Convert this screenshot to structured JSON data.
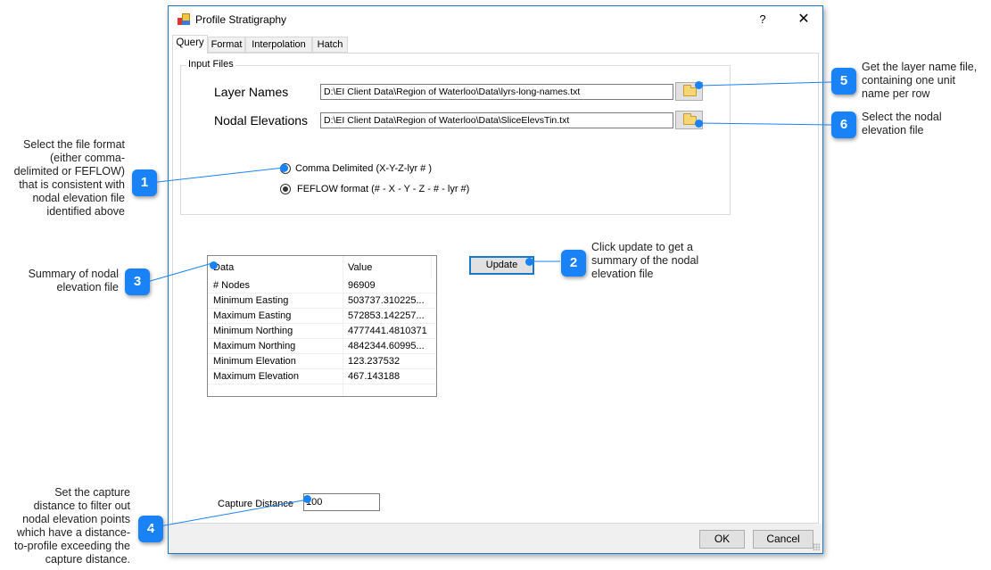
{
  "window": {
    "title": "Profile Stratigraphy",
    "help_label": "?",
    "close_label": "✕",
    "icon": "app-icon"
  },
  "tabs": [
    {
      "label": "Query",
      "active": true
    },
    {
      "label": "Format",
      "active": false
    },
    {
      "label": "Interpolation",
      "active": false
    },
    {
      "label": "Hatch",
      "active": false
    }
  ],
  "input_files": {
    "legend": "Input Files",
    "layer_names": {
      "label": "Layer Names",
      "value": "D:\\EI Client Data\\Region of Waterloo\\Data\\lyrs-long-names.txt",
      "browse_icon": "folder-open-icon"
    },
    "nodal_elevations": {
      "label": "Nodal Elevations",
      "value": "D:\\EI Client Data\\Region of Waterloo\\Data\\SliceElevsTin.txt",
      "browse_icon": "folder-open-icon"
    },
    "formats": [
      {
        "label": "Comma Delimited (X-Y-Z-lyr # )",
        "checked": false
      },
      {
        "label": "FEFLOW format (# - X - Y - Z - # - lyr #)",
        "checked": true
      }
    ]
  },
  "summary_grid": {
    "headers": [
      "Data",
      "Value"
    ],
    "rows": [
      [
        "# Nodes",
        "96909"
      ],
      [
        "Minimum Easting",
        "503737.310225..."
      ],
      [
        "Maximum Easting",
        "572853.142257..."
      ],
      [
        "Minimum Northing",
        "4777441.4810371"
      ],
      [
        "Maximum Northing",
        "4842344.60995..."
      ],
      [
        "Minimum Elevation",
        "123.237532"
      ],
      [
        "Maximum Elevation",
        "467.143188"
      ]
    ]
  },
  "update_label": "Update",
  "capture": {
    "label": "Capture Distance",
    "value": "100"
  },
  "footer": {
    "ok_label": "OK",
    "cancel_label": "Cancel"
  },
  "callouts": [
    {
      "number": "1",
      "text": "Select the file format (either comma-delimited or FEFLOW) that is consistent with nodal elevation file identified above",
      "lines": [
        "Select the file format",
        "(either comma-",
        "delimited or FEFLOW)",
        "that is consistent with",
        "nodal elevation file",
        "identified above"
      ]
    },
    {
      "number": "2",
      "text": "Click update to get a summary of the nodal elevation file",
      "lines": [
        "Click update to get a",
        "summary of the nodal",
        "elevation file"
      ]
    },
    {
      "number": "3",
      "text": "Summary of nodal elevation file",
      "lines": [
        "Summary of nodal",
        "elevation file"
      ]
    },
    {
      "number": "4",
      "text": "Set the capture distance to filter out nodal elevation points which have a distance-to-profile exceeding the capture distance.",
      "lines": [
        "Set the capture",
        "distance to filter out",
        "nodal elevation points",
        "which have a distance-",
        "to-profile exceeding the",
        "capture distance."
      ]
    },
    {
      "number": "5",
      "text": "Get the layer name file, containing one unit name per row",
      "lines": [
        "Get the layer name file,",
        "containing one unit",
        "name per row"
      ]
    },
    {
      "number": "6",
      "text": "Select the nodal elevation file",
      "lines": [
        "Select the nodal",
        "elevation file"
      ]
    }
  ],
  "colors": {
    "accent": "#1a82f7",
    "window_border": "#1979ca"
  }
}
